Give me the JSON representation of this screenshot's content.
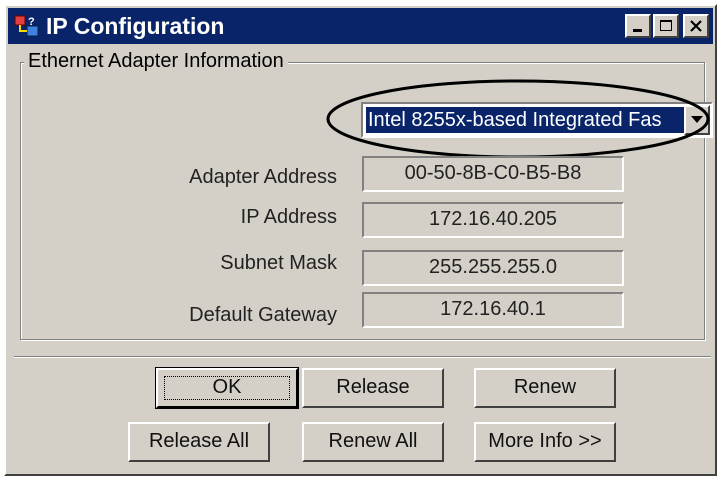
{
  "window": {
    "title": "IP Configuration",
    "controls": [
      "minimize-icon",
      "maximize-icon",
      "close-icon"
    ]
  },
  "group": {
    "legend": "Ethernet  Adapter Information"
  },
  "adapter_select": {
    "selected": "Intel 8255x-based Integrated Fas"
  },
  "fields": {
    "adapter_address_label": "Adapter Address",
    "adapter_address_value": "00-50-8B-C0-B5-B8",
    "ip_address_label": "IP Address",
    "ip_address_value": "172.16.40.205",
    "subnet_mask_label": "Subnet Mask",
    "subnet_mask_value": "255.255.255.0",
    "default_gateway_label": "Default Gateway",
    "default_gateway_value": "172.16.40.1"
  },
  "buttons": {
    "ok": "OK",
    "release": "Release",
    "renew": "Renew",
    "release_all": "Release All",
    "renew_all": "Renew All",
    "more_info": "More Info >>"
  },
  "colors": {
    "titlebar": "#0a246a",
    "dialog_face": "#d4d0c8",
    "selection": "#0a246a"
  }
}
